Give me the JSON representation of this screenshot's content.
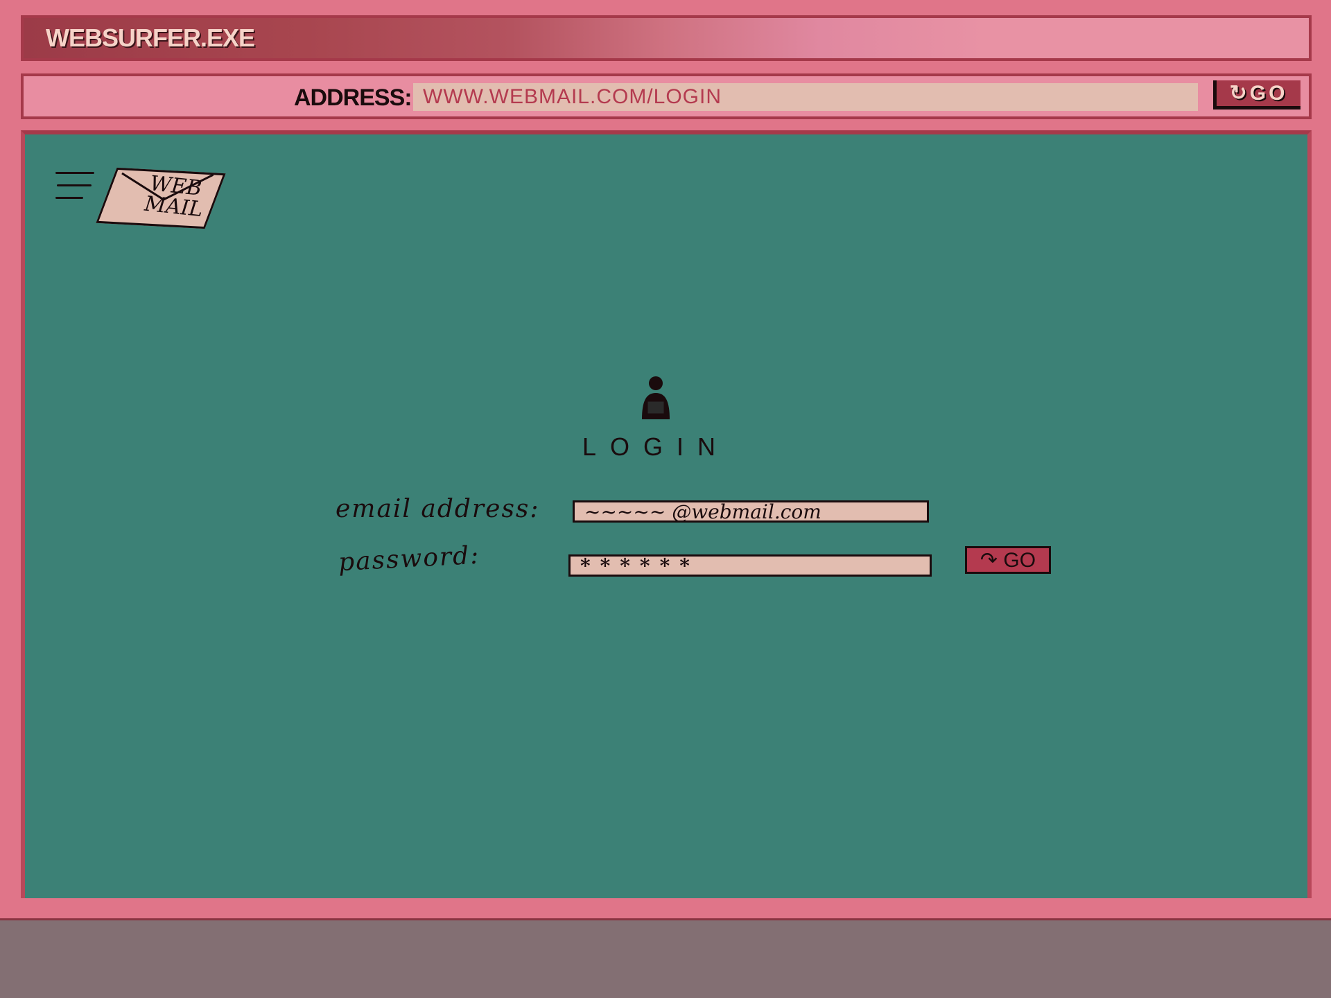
{
  "window": {
    "title": "WEBSURFER.EXE"
  },
  "address_bar": {
    "label": "ADDRESS:",
    "url": "WWW.WEBMAIL.COM/LOGIN",
    "go_label": "GO",
    "go_icon": "reload-arrow-icon"
  },
  "logo": {
    "line1": "WEB",
    "line2": "MAIL",
    "icon": "envelope-icon"
  },
  "login": {
    "icon": "user-icon",
    "title": "LOGIN",
    "email_label": "email address:",
    "email_value": "~~~~~ @webmail.com",
    "password_label": "password:",
    "password_value": "******",
    "go_label": "GO",
    "go_icon": "reload-arrow-icon"
  },
  "colors": {
    "window_frame": "#e07589",
    "frame_border": "#a5394a",
    "content_bg": "#3c8176",
    "field_bg": "#e2bdb0",
    "accent": "#b43a4f",
    "desktop": "#836f73"
  }
}
